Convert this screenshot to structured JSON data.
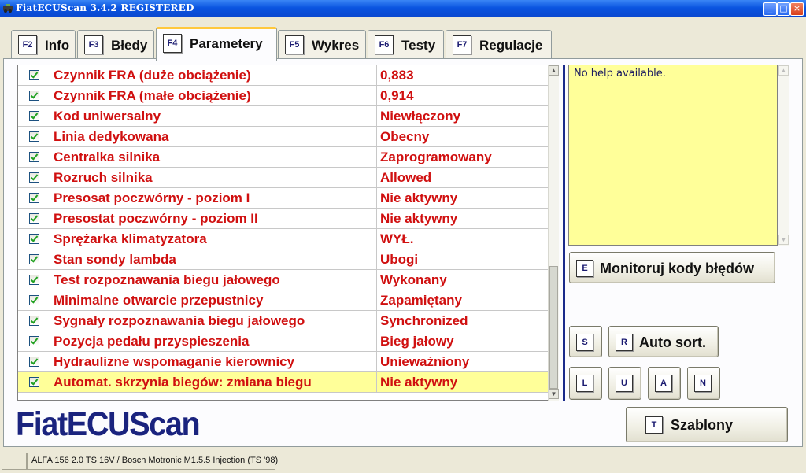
{
  "window": {
    "title": "FiatECUScan 3.4.2 REGISTERED",
    "minimize": "_",
    "maximize": "□",
    "close": "×"
  },
  "tabs": [
    {
      "key": "F2",
      "label": "Info"
    },
    {
      "key": "F3",
      "label": "Błedy"
    },
    {
      "key": "F4",
      "label": "Parametery",
      "active": true
    },
    {
      "key": "F5",
      "label": "Wykres"
    },
    {
      "key": "F6",
      "label": "Testy"
    },
    {
      "key": "F7",
      "label": "Regulacje"
    }
  ],
  "parameters": [
    {
      "name": "Czynnik FRA (duże obciążenie)",
      "value": "0,883"
    },
    {
      "name": "Czynnik FRA (małe obciążenie)",
      "value": "0,914"
    },
    {
      "name": "Kod uniwersalny",
      "value": "Niewłączony"
    },
    {
      "name": "Linia dedykowana",
      "value": "Obecny"
    },
    {
      "name": "Centralka silnika",
      "value": "Zaprogramowany"
    },
    {
      "name": "Rozruch silnika",
      "value": "Allowed"
    },
    {
      "name": "Presosat poczwórny - poziom I",
      "value": "Nie aktywny"
    },
    {
      "name": "Presostat poczwórny - poziom II",
      "value": "Nie aktywny"
    },
    {
      "name": "Sprężarka klimatyzatora",
      "value": "WYŁ."
    },
    {
      "name": "Stan sondy lambda",
      "value": "Ubogi"
    },
    {
      "name": "Test rozpoznawania biegu jałowego",
      "value": "Wykonany"
    },
    {
      "name": "Minimalne otwarcie przepustnicy",
      "value": "Zapamiętany"
    },
    {
      "name": "Sygnały rozpoznawania biegu jałowego",
      "value": "Synchronized"
    },
    {
      "name": "Pozycja pedału przyspieszenia",
      "value": "Bieg jałowy"
    },
    {
      "name": "Hydraulizne wspomaganie kierownicy",
      "value": "Unieważniony"
    },
    {
      "name": "Automat. skrzynia biegów: zmiana biegu",
      "value": "Nie aktywny",
      "selected": true
    }
  ],
  "help": {
    "text": "No help available."
  },
  "buttons": {
    "monitor": {
      "key": "E",
      "label": "Monitoruj kody błędów"
    },
    "sort_s": {
      "key": "S"
    },
    "auto_sort": {
      "key": "R",
      "label": "Auto sort."
    },
    "l": {
      "key": "L"
    },
    "u": {
      "key": "U"
    },
    "a": {
      "key": "A"
    },
    "n": {
      "key": "N"
    },
    "templates": {
      "key": "T",
      "label": "Szablony"
    }
  },
  "logo": {
    "text": "FiatECUScan"
  },
  "status": {
    "vehicle": "ALFA 156 2.0 TS 16V / Bosch Motronic M1.5.5 Injection (TS '98)"
  },
  "colors": {
    "accent_title": "#0a54e0",
    "param_text": "#d01010",
    "selection": "#ffff99",
    "logo": "#1a237e",
    "divider": "#1a2a8a"
  }
}
